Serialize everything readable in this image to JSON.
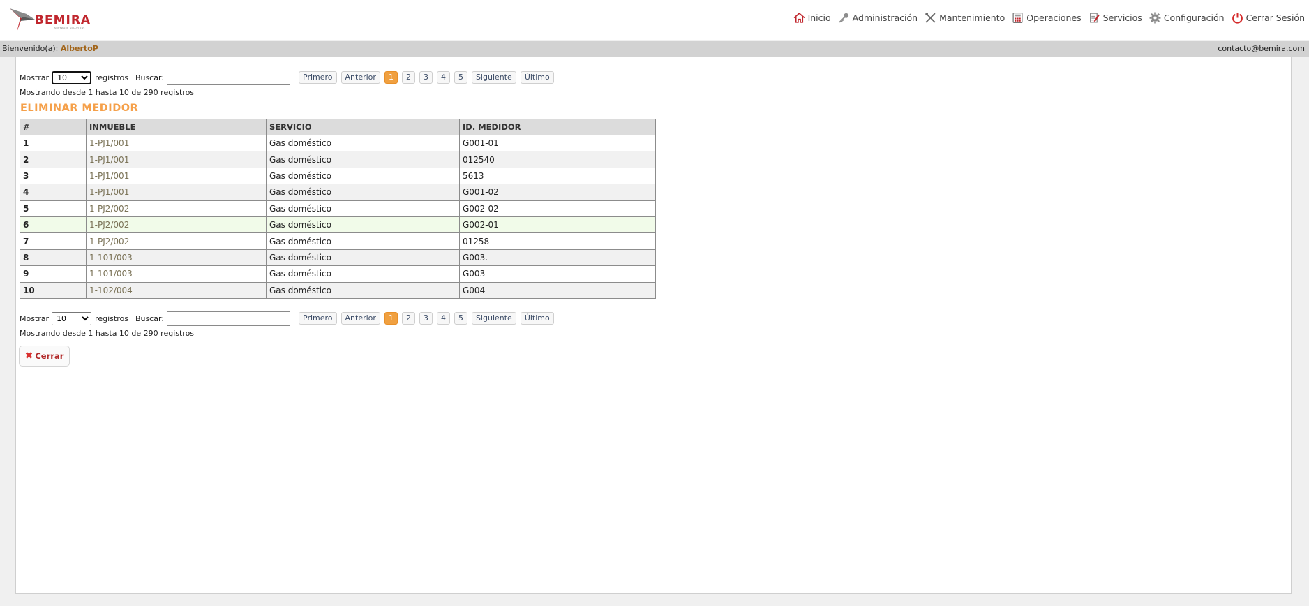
{
  "brand": {
    "name": "BEMIRA",
    "tagline": "SOFTWARE SOLUTIONS",
    "accent": "#c0262d"
  },
  "nav": [
    {
      "label": "Inicio",
      "icon": "home-icon"
    },
    {
      "label": "Administración",
      "icon": "key-icon"
    },
    {
      "label": "Mantenimiento",
      "icon": "tools-icon"
    },
    {
      "label": "Operaciones",
      "icon": "calculator-icon"
    },
    {
      "label": "Servicios",
      "icon": "document-edit-icon"
    },
    {
      "label": "Configuración",
      "icon": "gear-icon"
    },
    {
      "label": "Cerrar Sesión",
      "icon": "power-icon"
    }
  ],
  "welcome": {
    "label": "Bienvenido(a):",
    "user": "AlbertoP",
    "email": "contacto@bemira.com"
  },
  "controls": {
    "show_label": "Mostrar",
    "page_size": "10",
    "page_size_options": [
      "10"
    ],
    "records_label": "registros",
    "search_label": "Buscar:",
    "search_value": "",
    "first": "Primero",
    "previous": "Anterior",
    "pages": [
      "1",
      "2",
      "3",
      "4",
      "5"
    ],
    "current_page": "1",
    "next": "Siguiente",
    "last": "Último",
    "info": "Mostrando desde 1 hasta 10 de 290 registros"
  },
  "section_title": "ELIMINAR MEDIDOR",
  "table": {
    "headers": [
      "#",
      "INMUEBLE",
      "SERVICIO",
      "ID. MEDIDOR"
    ],
    "rows": [
      [
        "1",
        "1-PJ1/001",
        "Gas doméstico",
        "G001-01"
      ],
      [
        "2",
        "1-PJ1/001",
        "Gas doméstico",
        "012540"
      ],
      [
        "3",
        "1-PJ1/001",
        "Gas doméstico",
        "5613"
      ],
      [
        "4",
        "1-PJ1/001",
        "Gas doméstico",
        "G001-02"
      ],
      [
        "5",
        "1-PJ2/002",
        "Gas doméstico",
        "G002-02"
      ],
      [
        "6",
        "1-PJ2/002",
        "Gas doméstico",
        "G002-01"
      ],
      [
        "7",
        "1-PJ2/002",
        "Gas doméstico",
        "01258"
      ],
      [
        "8",
        "1-101/003",
        "Gas doméstico",
        "G003."
      ],
      [
        "9",
        "1-101/003",
        "Gas doméstico",
        "G003"
      ],
      [
        "10",
        "1-102/004",
        "Gas doméstico",
        "G004"
      ]
    ]
  },
  "close_button": "Cerrar"
}
